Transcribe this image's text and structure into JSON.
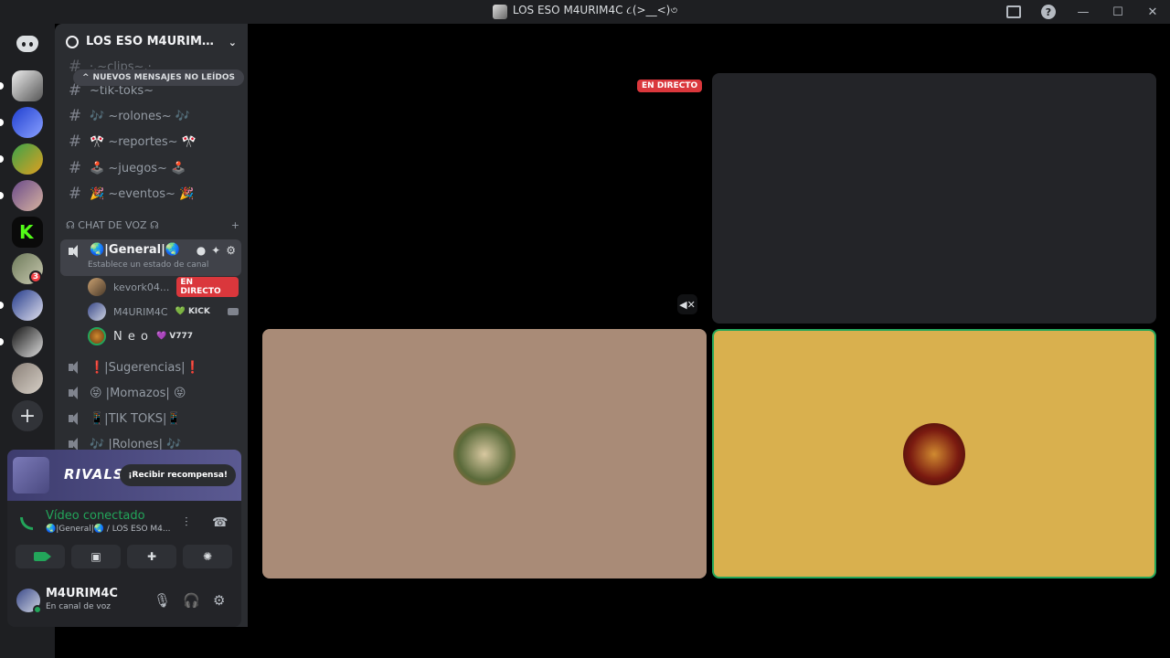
{
  "window": {
    "title": "LOS ESO M4URIM4C ૮(>__<)৩"
  },
  "guild": {
    "name": "LOS ESO M4URIM4C ૮(>__<)৩"
  },
  "unread": {
    "label": "NUEVOS MENSAJES NO LEÍDOS"
  },
  "text_channels": [
    {
      "name": "·.~clips~.·"
    },
    {
      "name": "~tik-toks~"
    },
    {
      "name": "🎶 ~rolones~ 🎶"
    },
    {
      "name": "🎌 ~reportes~ 🎌"
    },
    {
      "name": "🕹️ ~juegos~ 🕹️"
    },
    {
      "name": "🎉 ~eventos~ 🎉"
    }
  ],
  "voice_category": {
    "label": "☊ CHAT DE VOZ ☊"
  },
  "active_voice": {
    "name": "🌏|General|🌏",
    "status": "Establece un estado de canal"
  },
  "members": [
    {
      "name": "kevork04...",
      "badge": "EN DIRECTO"
    },
    {
      "name": "M4URIM4C",
      "tag": "💚 KICK"
    },
    {
      "name": "N e o",
      "tag": "💜 V777"
    }
  ],
  "voice_channels": [
    {
      "name": "❗|Sugerencias|❗"
    },
    {
      "name": "😝 |Momazos| 😝"
    },
    {
      "name": "📱|TIK TOKS|📱"
    },
    {
      "name": "🎶 |Rolones| 🎶"
    }
  ],
  "promo": {
    "brand": "RIVALS",
    "button": "¡Recibir recompensa!"
  },
  "connection": {
    "status": "Vídeo conectado",
    "location": "🌏|General|🌏 / LOS ESO M4..."
  },
  "user": {
    "name": "M4URIM4C",
    "status": "En canal de voz"
  },
  "stage": {
    "live_badge": "EN DIRECTO"
  },
  "colors": {
    "accent_green": "#23a55a",
    "live_red": "#da373c",
    "tile_one_bg": "#a98b77",
    "tile_two_bg": "#d9b04e"
  }
}
